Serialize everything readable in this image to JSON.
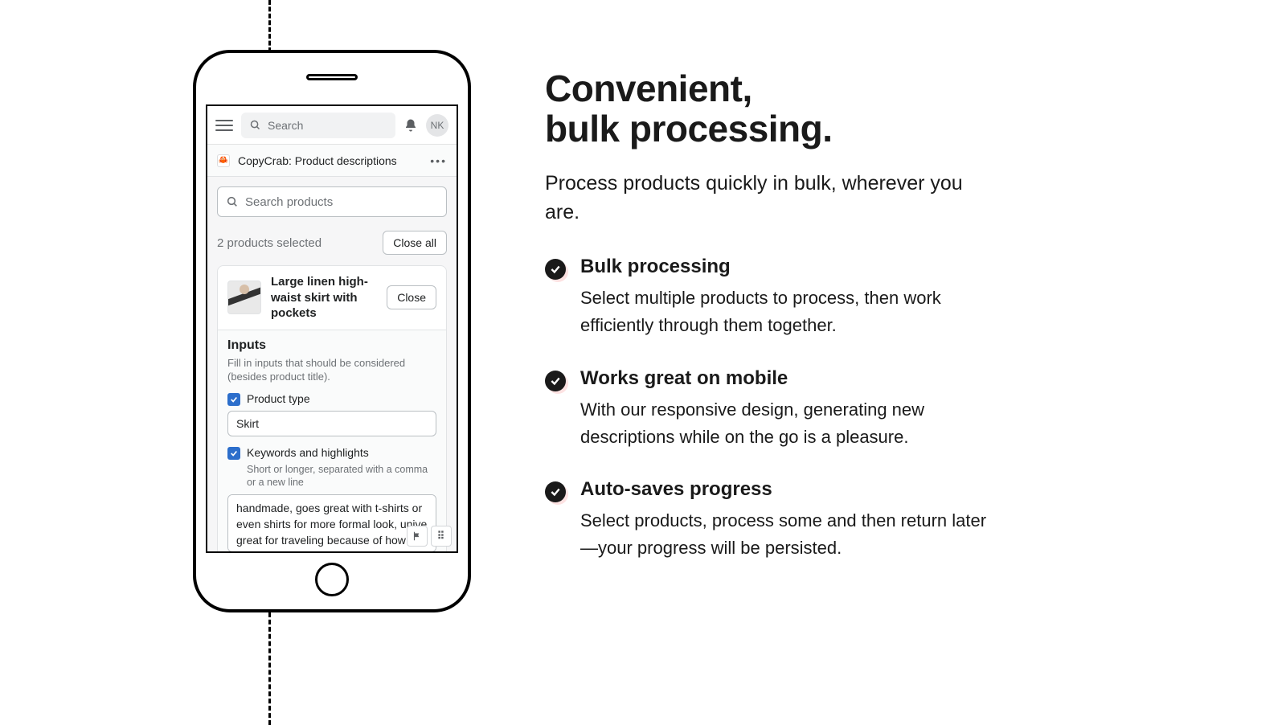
{
  "topbar": {
    "search_placeholder": "Search",
    "avatar_initials": "NK"
  },
  "app": {
    "title": "CopyCrab: Product descriptions",
    "icon_glyph": "🦀"
  },
  "products_search_placeholder": "Search products",
  "selection_summary": "2 products selected",
  "close_all_label": "Close all",
  "product": {
    "title": "Large linen high-waist skirt with pockets",
    "close_label": "Close"
  },
  "inputs": {
    "heading": "Inputs",
    "description": "Fill in inputs that should be considered (besides product title).",
    "product_type": {
      "label": "Product type",
      "value": "Skirt",
      "checked": true
    },
    "keywords": {
      "label": "Keywords and highlights",
      "hint": "Short or longer, separated with a comma or a new line",
      "value": "handmade, goes great with t-shirts or even shirts for more formal look, unive great for traveling because of how",
      "checked": true
    }
  },
  "marketing": {
    "headline_l1": "Convenient,",
    "headline_l2": "bulk processing.",
    "lead": "Process products quickly in bulk, wherever you are.",
    "features": [
      {
        "title": "Bulk processing",
        "body": "Select multiple products to process, then work efficiently through them together."
      },
      {
        "title": "Works great on mobile",
        "body": "With our responsive design, generating new descriptions while on the go is a pleasure."
      },
      {
        "title": "Auto-saves progress",
        "body": "Select products, process some and then return later—your progress will be persisted."
      }
    ]
  }
}
